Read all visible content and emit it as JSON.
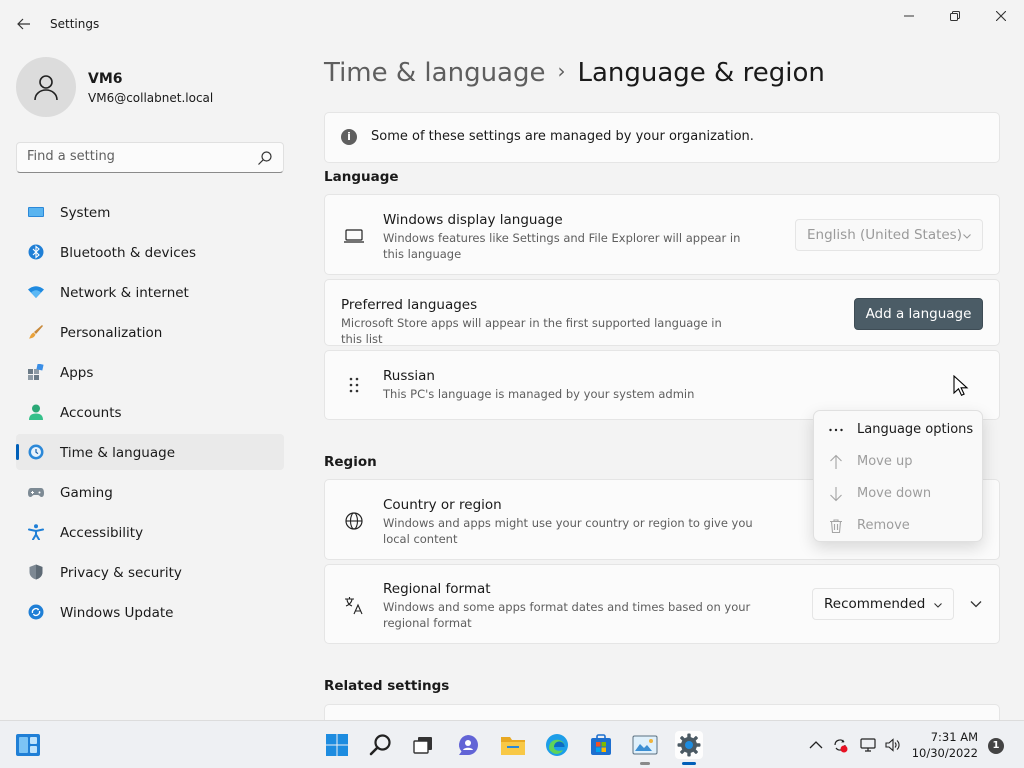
{
  "window": {
    "title": "Settings"
  },
  "profile": {
    "name": "VM6",
    "email": "VM6@collabnet.local"
  },
  "search": {
    "placeholder": "Find a setting"
  },
  "sidebar": {
    "items": [
      {
        "label": "System",
        "icon": "system-icon"
      },
      {
        "label": "Bluetooth & devices",
        "icon": "bluetooth-icon"
      },
      {
        "label": "Network & internet",
        "icon": "wifi-icon"
      },
      {
        "label": "Personalization",
        "icon": "brush-icon"
      },
      {
        "label": "Apps",
        "icon": "apps-icon"
      },
      {
        "label": "Accounts",
        "icon": "person-icon"
      },
      {
        "label": "Time & language",
        "icon": "clock-globe-icon",
        "selected": true
      },
      {
        "label": "Gaming",
        "icon": "gamepad-icon"
      },
      {
        "label": "Accessibility",
        "icon": "accessibility-icon"
      },
      {
        "label": "Privacy & security",
        "icon": "shield-icon"
      },
      {
        "label": "Windows Update",
        "icon": "update-icon"
      }
    ]
  },
  "breadcrumb": {
    "parent": "Time & language",
    "separator": "›",
    "current": "Language & region"
  },
  "info_bar": {
    "text": "Some of these settings are managed by your organization."
  },
  "language_section": {
    "label": "Language",
    "display_language": {
      "title": "Windows display language",
      "description": "Windows features like Settings and File Explorer will appear in this language",
      "selected": "English (United States)"
    },
    "preferred": {
      "title": "Preferred languages",
      "description": "Microsoft Store apps will appear in the first supported language in this list",
      "button": "Add a language"
    },
    "russian": {
      "title": "Russian",
      "description": "This PC's language is managed by your system admin"
    }
  },
  "context_menu": {
    "items": [
      {
        "label": "Language options",
        "icon": "more-icon",
        "enabled": true
      },
      {
        "label": "Move up",
        "icon": "arrow-up-icon",
        "enabled": false
      },
      {
        "label": "Move down",
        "icon": "arrow-down-icon",
        "enabled": false
      },
      {
        "label": "Remove",
        "icon": "trash-icon",
        "enabled": false
      }
    ]
  },
  "region_section": {
    "label": "Region",
    "country": {
      "title": "Country or region",
      "description": "Windows and apps might use your country or region to give you local content"
    },
    "format": {
      "title": "Regional format",
      "description": "Windows and some apps format dates and times based on your regional format",
      "selected": "Recommended"
    }
  },
  "related": {
    "label": "Related settings"
  },
  "taskbar": {
    "time": "7:31 AM",
    "date": "10/30/2022",
    "notification_count": "1"
  },
  "colors": {
    "accent": "#005fb8",
    "button": "#4b5c66"
  }
}
